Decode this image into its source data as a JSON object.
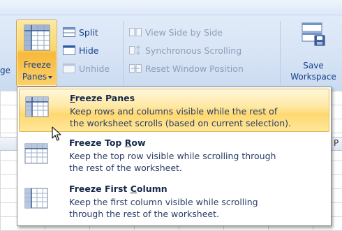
{
  "ribbon": {
    "cut_label": "ge",
    "freeze_button": {
      "line1": "Freeze",
      "line2": "Panes",
      "icon": "freeze-panes-icon"
    },
    "window_group_left": [
      {
        "label": "Split",
        "icon": "split-icon",
        "enabled": true
      },
      {
        "label": "Hide",
        "icon": "hide-icon",
        "enabled": true
      },
      {
        "label": "Unhide",
        "icon": "unhide-icon",
        "enabled": false
      }
    ],
    "window_group_right": [
      {
        "label": "View Side by Side",
        "icon": "view-side-by-side-icon",
        "enabled": false
      },
      {
        "label": "Synchronous Scrolling",
        "icon": "synchronous-scrolling-icon",
        "enabled": false
      },
      {
        "label": "Reset Window Position",
        "icon": "reset-window-position-icon",
        "enabled": false
      }
    ],
    "save_workspace": {
      "line1": "Save",
      "line2": "Workspace",
      "icon": "save-workspace-icon"
    }
  },
  "sheet": {
    "column_letter": "P"
  },
  "menu": {
    "items": [
      {
        "title_pre": "",
        "title_u": "F",
        "title_post": "reeze Panes",
        "desc1": "Keep rows and columns visible while the rest of",
        "desc2": "the worksheet scrolls (based on current selection).",
        "icon": "freeze-panes-icon",
        "highlighted": true
      },
      {
        "title_pre": "Freeze Top ",
        "title_u": "R",
        "title_post": "ow",
        "desc1": "Keep the top row visible while scrolling through",
        "desc2": "the rest of the worksheet.",
        "icon": "freeze-top-row-icon",
        "highlighted": false
      },
      {
        "title_pre": "Freeze First ",
        "title_u": "C",
        "title_post": "olumn",
        "desc1": "Keep the first column visible while scrolling",
        "desc2": "through the rest of the worksheet.",
        "icon": "freeze-first-column-icon",
        "highlighted": false
      }
    ]
  },
  "colors": {
    "highlight_top": "#fff7d9",
    "highlight_bottom": "#ffd871",
    "highlight_border": "#e3b64a",
    "ribbon_text": "#15428b",
    "disabled_text": "#8d9fb8"
  }
}
